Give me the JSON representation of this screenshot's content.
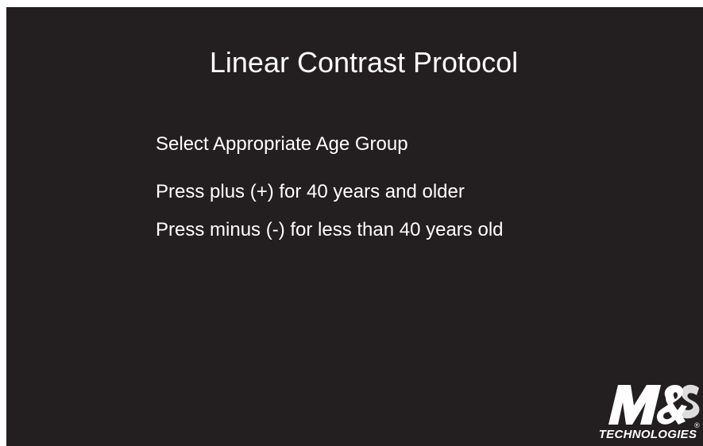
{
  "screen": {
    "title": "Linear Contrast Protocol",
    "prompt": "Select Appropriate Age Group",
    "options": [
      "Press plus (+) for 40 years and older",
      "Press minus (-) for less than 40 years old"
    ]
  },
  "logo": {
    "brand": "M&S",
    "subtitle": "TECHNOLOGIES",
    "registered": "®"
  },
  "colors": {
    "background": "#231f20",
    "text": "#ffffff"
  }
}
